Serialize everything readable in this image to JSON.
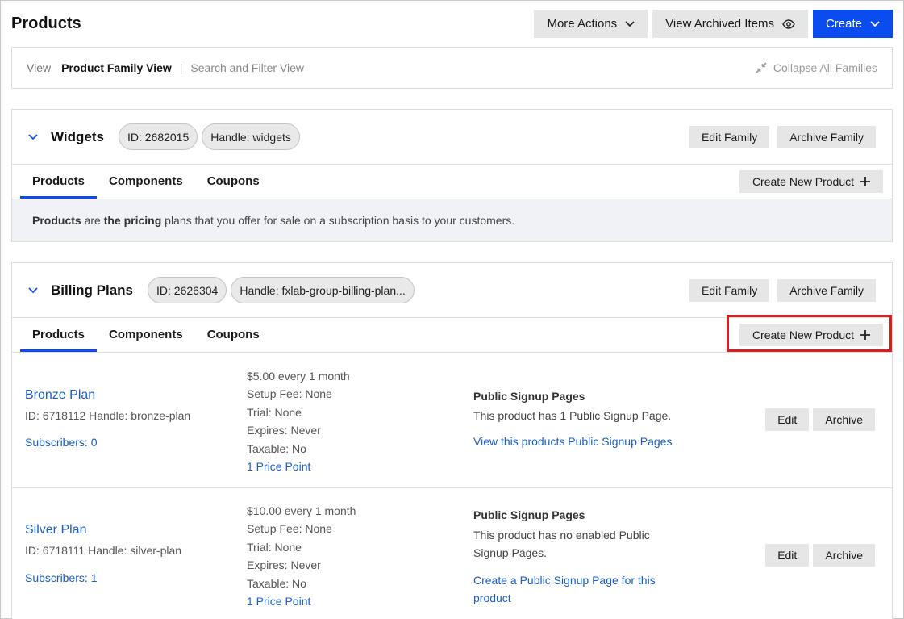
{
  "header": {
    "title": "Products",
    "more_actions": "More Actions",
    "view_archived": "View Archived Items",
    "create": "Create"
  },
  "view_bar": {
    "label": "View",
    "active": "Product Family View",
    "separator": "|",
    "other": "Search and Filter View",
    "collapse": "Collapse All Families"
  },
  "families": [
    {
      "name": "Widgets",
      "id_pill": "ID: 2682015",
      "handle_pill": "Handle: widgets",
      "edit": "Edit Family",
      "archive": "Archive Family",
      "tabs": [
        "Products",
        "Components",
        "Coupons"
      ],
      "create_product": "Create New Product",
      "info_b1": "Products",
      "info_t1": " are ",
      "info_b2": "the pricing",
      "info_t2": " plans that you offer for sale on a subscription basis to your customers."
    },
    {
      "name": "Billing Plans",
      "id_pill": "ID: 2626304",
      "handle_pill": "Handle: fxlab-group-billing-plan...",
      "edit": "Edit Family",
      "archive": "Archive Family",
      "tabs": [
        "Products",
        "Components",
        "Coupons"
      ],
      "create_product": "Create New Product",
      "products": [
        {
          "name": "Bronze Plan",
          "meta": "ID: 6718112 Handle: bronze-plan",
          "subscribers": "Subscribers: 0",
          "price": "$5.00 every 1 month",
          "setup_fee": "Setup Fee: None",
          "trial": "Trial: None",
          "expires": "Expires: Never",
          "taxable": "Taxable: No",
          "price_points": "1 Price Point",
          "signup_title": "Public Signup Pages",
          "signup_text": "This product has 1 Public Signup Page.",
          "signup_link": "View this products Public Signup Pages",
          "edit": "Edit",
          "archive": "Archive"
        },
        {
          "name": "Silver Plan",
          "meta": "ID: 6718111 Handle: silver-plan",
          "subscribers": "Subscribers: 1",
          "price": "$10.00 every 1 month",
          "setup_fee": "Setup Fee: None",
          "trial": "Trial: None",
          "expires": "Expires: Never",
          "taxable": "Taxable: No",
          "price_points": "1 Price Point",
          "signup_title": "Public Signup Pages",
          "signup_text": "This product has no enabled Public Signup Pages.",
          "signup_link": "Create a Public Signup Page for this product",
          "edit": "Edit",
          "archive": "Archive"
        }
      ]
    }
  ],
  "colors": {
    "primary": "#0a4cf0",
    "link": "#1a5ec6",
    "highlight": "#d91e1e"
  }
}
